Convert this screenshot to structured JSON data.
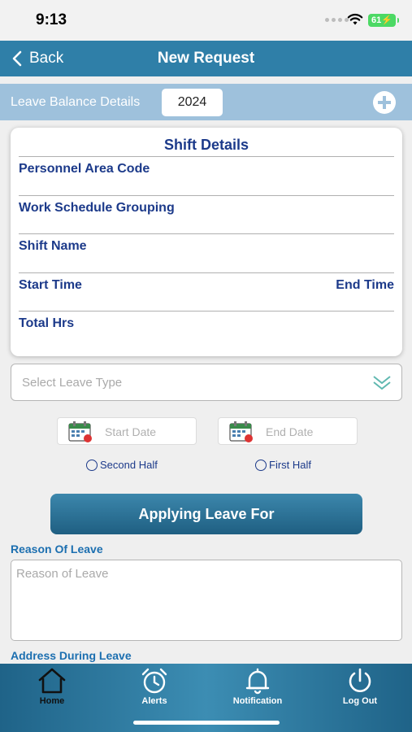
{
  "status_bar": {
    "time": "9:13",
    "battery": "61"
  },
  "nav": {
    "back_label": "Back",
    "title": "New Request"
  },
  "leave_balance": {
    "label": "Leave Balance Details",
    "year": "2024"
  },
  "shift_details": {
    "title": "Shift Details",
    "personnel_area_code": "Personnel Area Code",
    "work_schedule_grouping": "Work Schedule Grouping",
    "shift_name": "Shift Name",
    "start_time": "Start Time",
    "end_time": "End Time",
    "total_hrs": "Total Hrs"
  },
  "leave_type": {
    "placeholder": "Select Leave Type"
  },
  "dates": {
    "start_placeholder": "Start Date",
    "end_placeholder": "End Date"
  },
  "half_day": {
    "second_half": "Second Half",
    "first_half": "First Half"
  },
  "apply_button": "Applying Leave For",
  "reason": {
    "label": "Reason Of Leave",
    "placeholder": "Reason of Leave"
  },
  "address": {
    "label": "Address During Leave"
  },
  "tabs": [
    {
      "label": "Home",
      "icon": "home-icon"
    },
    {
      "label": "Alerts",
      "icon": "alarm-clock-icon"
    },
    {
      "label": "Notification",
      "icon": "bell-icon"
    },
    {
      "label": "Log Out",
      "icon": "power-icon"
    }
  ],
  "colors": {
    "nav": "#2f7fa8",
    "balance_bar": "#9ec1dc",
    "label_blue": "#1c3a8a",
    "tab_bar": "#2a75a0"
  }
}
